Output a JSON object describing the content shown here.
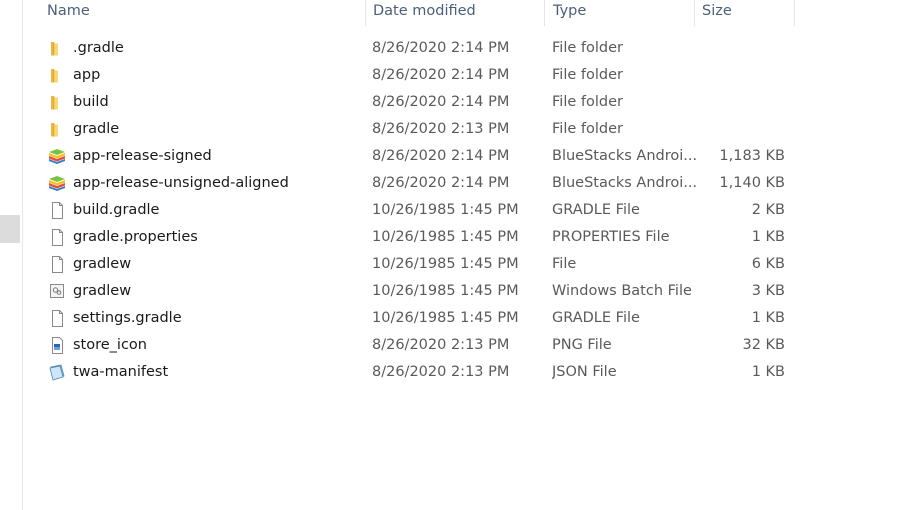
{
  "columns": {
    "name": "Name",
    "date": "Date modified",
    "type": "Type",
    "size": "Size"
  },
  "files": [
    {
      "name": ".gradle",
      "date": "8/26/2020 2:14 PM",
      "type": "File folder",
      "size": "",
      "icon": "folder-icon"
    },
    {
      "name": "app",
      "date": "8/26/2020 2:14 PM",
      "type": "File folder",
      "size": "",
      "icon": "folder-icon"
    },
    {
      "name": "build",
      "date": "8/26/2020 2:14 PM",
      "type": "File folder",
      "size": "",
      "icon": "folder-icon"
    },
    {
      "name": "gradle",
      "date": "8/26/2020 2:13 PM",
      "type": "File folder",
      "size": "",
      "icon": "folder-icon"
    },
    {
      "name": "app-release-signed",
      "date": "8/26/2020 2:14 PM",
      "type": "BlueStacks Androi...",
      "size": "1,183 KB",
      "icon": "bluestacks-apk-icon"
    },
    {
      "name": "app-release-unsigned-aligned",
      "date": "8/26/2020 2:14 PM",
      "type": "BlueStacks Androi...",
      "size": "1,140 KB",
      "icon": "bluestacks-apk-icon"
    },
    {
      "name": "build.gradle",
      "date": "10/26/1985 1:45 PM",
      "type": "GRADLE File",
      "size": "2 KB",
      "icon": "blank-file-icon"
    },
    {
      "name": "gradle.properties",
      "date": "10/26/1985 1:45 PM",
      "type": "PROPERTIES File",
      "size": "1 KB",
      "icon": "blank-file-icon"
    },
    {
      "name": "gradlew",
      "date": "10/26/1985 1:45 PM",
      "type": "File",
      "size": "6 KB",
      "icon": "blank-file-icon"
    },
    {
      "name": "gradlew",
      "date": "10/26/1985 1:45 PM",
      "type": "Windows Batch File",
      "size": "3 KB",
      "icon": "batch-file-icon"
    },
    {
      "name": "settings.gradle",
      "date": "10/26/1985 1:45 PM",
      "type": "GRADLE File",
      "size": "1 KB",
      "icon": "blank-file-icon"
    },
    {
      "name": "store_icon",
      "date": "8/26/2020 2:13 PM",
      "type": "PNG File",
      "size": "32 KB",
      "icon": "image-file-icon"
    },
    {
      "name": "twa-manifest",
      "date": "8/26/2020 2:13 PM",
      "type": "JSON File",
      "size": "1 KB",
      "icon": "json-file-icon"
    }
  ]
}
